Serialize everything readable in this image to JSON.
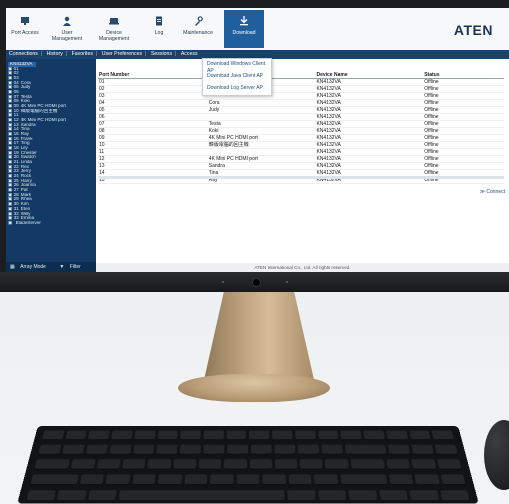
{
  "toolbar": {
    "items": [
      {
        "label": "Port Access"
      },
      {
        "label": "User Management"
      },
      {
        "label": "Device Management"
      },
      {
        "label": "Log"
      },
      {
        "label": "Maintenance"
      },
      {
        "label": "Download"
      }
    ],
    "logo": "ATEN"
  },
  "tabs": [
    "Connections",
    "History",
    "Favorites",
    "User Preferences",
    "Sessions",
    "Access"
  ],
  "download_menu": [
    "Download Windows Client AP",
    "Download Java Client AP",
    "Download Log Server AP"
  ],
  "sidebar": {
    "root": "KN4132VA",
    "items": [
      {
        "num": "01",
        "name": ""
      },
      {
        "num": "02",
        "name": ""
      },
      {
        "num": "03",
        "name": ""
      },
      {
        "num": "04",
        "name": "Cora"
      },
      {
        "num": "05",
        "name": "Judy"
      },
      {
        "num": "06",
        "name": ""
      },
      {
        "num": "07",
        "name": "Testa"
      },
      {
        "num": "08",
        "name": "Koki"
      },
      {
        "num": "09",
        "name": "4K Mini PC HDMI port"
      },
      {
        "num": "10",
        "name": "韓版電腦的回主機"
      },
      {
        "num": "11",
        "name": ""
      },
      {
        "num": "12",
        "name": "4K Mini PC HDMI port"
      },
      {
        "num": "13",
        "name": "Sandra"
      },
      {
        "num": "14",
        "name": "Tina"
      },
      {
        "num": "15",
        "name": "Ray"
      },
      {
        "num": "16",
        "name": "Frank"
      },
      {
        "num": "17",
        "name": "Ting"
      },
      {
        "num": "18",
        "name": "Lily"
      },
      {
        "num": "19",
        "name": "Chester"
      },
      {
        "num": "20",
        "name": "Swatch"
      },
      {
        "num": "21",
        "name": "Linda"
      },
      {
        "num": "22",
        "name": "Rex"
      },
      {
        "num": "23",
        "name": "Jerry"
      },
      {
        "num": "24",
        "name": "Rock"
      },
      {
        "num": "25",
        "name": "Harry"
      },
      {
        "num": "26",
        "name": "Joanna"
      },
      {
        "num": "27",
        "name": "Pat"
      },
      {
        "num": "28",
        "name": "Mark"
      },
      {
        "num": "29",
        "name": "Rhea"
      },
      {
        "num": "30",
        "name": "Kim"
      },
      {
        "num": "31",
        "name": "Eten"
      },
      {
        "num": "32",
        "name": "Willy"
      },
      {
        "num": "33",
        "name": "Emma"
      },
      {
        "num": "",
        "name": "BladeServer"
      }
    ],
    "footer_array": "Array Mode",
    "footer_filter": "Filter"
  },
  "table": {
    "headers": [
      "Port Number",
      "Port Name",
      "Device Name",
      "Status"
    ],
    "rows": [
      [
        "01",
        "",
        "KN4132VA",
        "Offline"
      ],
      [
        "02",
        "",
        "KN4132VA",
        "Offline"
      ],
      [
        "03",
        "",
        "KN4132VA",
        "Offline"
      ],
      [
        "04",
        "Cora",
        "KN4132VA",
        "Offline"
      ],
      [
        "05",
        "Judy",
        "KN4132VA",
        "Offline"
      ],
      [
        "06",
        "",
        "KN4132VA",
        "Offline"
      ],
      [
        "07",
        "Testa",
        "KN4132VA",
        "Offline"
      ],
      [
        "08",
        "Koki",
        "KN4132VA",
        "Offline"
      ],
      [
        "09",
        "4K Mini PC HDMI port",
        "KN4132VA",
        "Offline"
      ],
      [
        "10",
        "韓版電腦的回主機",
        "KN4132VA",
        "Offline"
      ],
      [
        "11",
        "",
        "KN4132VA",
        "Offline"
      ],
      [
        "12",
        "4K Mini PC HDMI port",
        "KN4132VA",
        "Offline"
      ],
      [
        "13",
        "Sandra",
        "KN4132VA",
        "Offline"
      ],
      [
        "14",
        "Tina",
        "KN4132VA",
        "Offline"
      ],
      [
        "15",
        "Ray",
        "KN4132VA",
        "Offline"
      ]
    ]
  },
  "connect_label": "Connect",
  "copyright": "ATEN International Co., Ltd. All rights reserved.",
  "colors": {
    "nav_blue": "#17416e",
    "active_tab": "#1f5f9e",
    "link_blue": "#1f4e85"
  }
}
